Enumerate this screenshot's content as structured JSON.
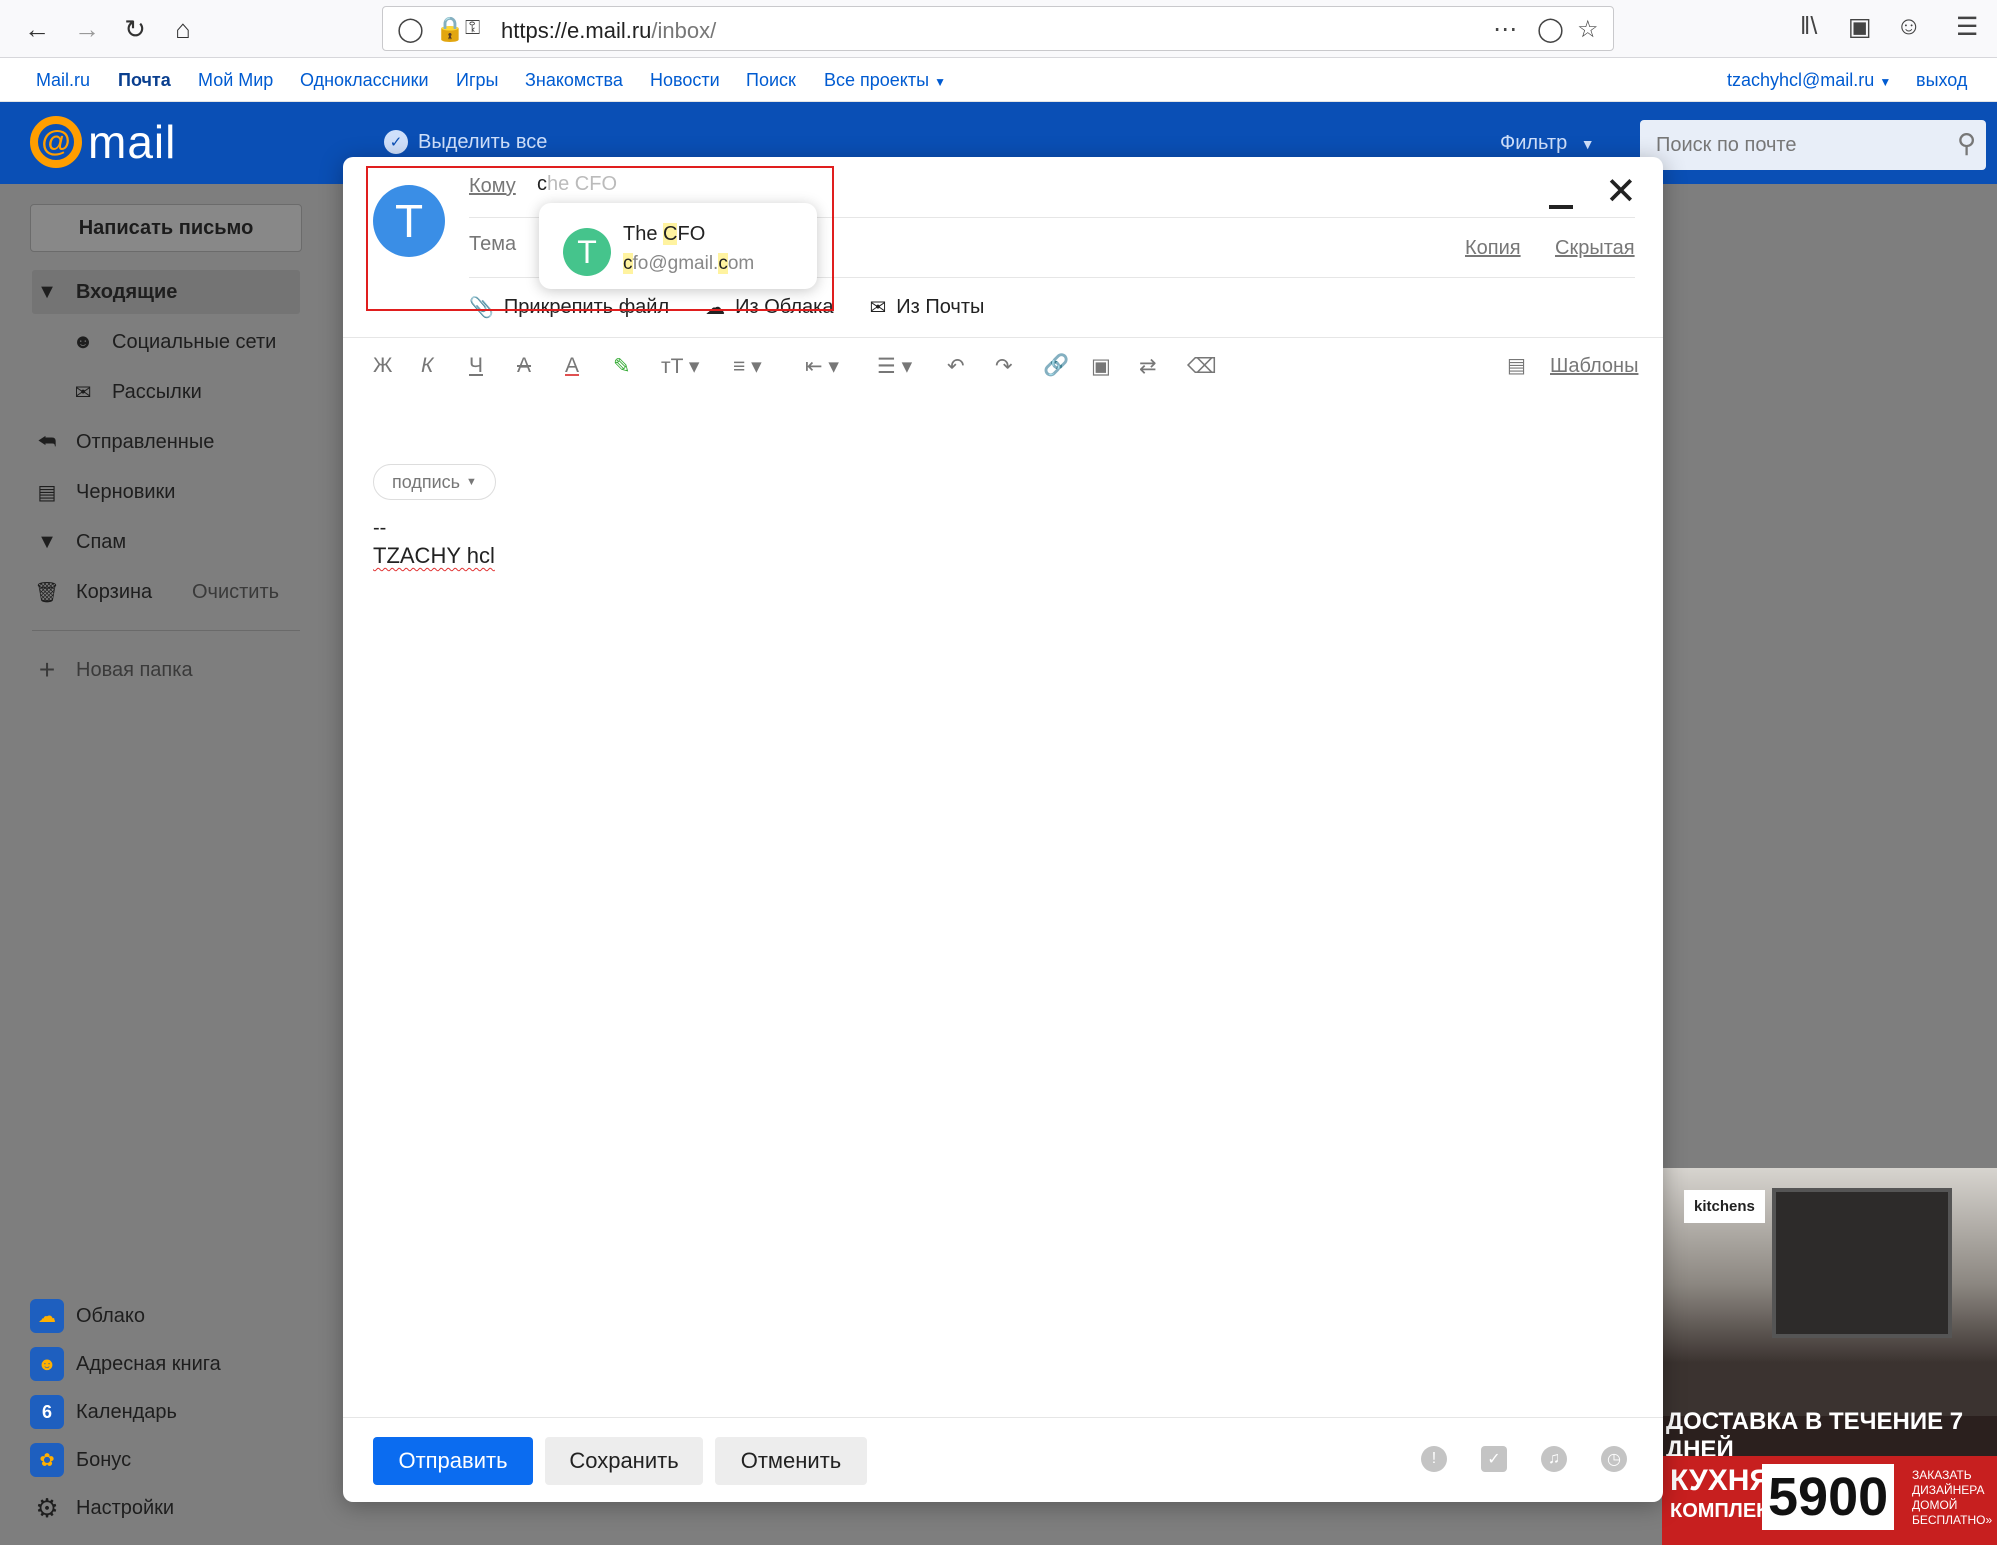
{
  "browser": {
    "url_host": "https://e.mail.ru",
    "url_path": "/inbox/"
  },
  "portal": {
    "links": [
      "Mail.ru",
      "Почта",
      "Мой Мир",
      "Одноклассники",
      "Игры",
      "Знакомства",
      "Новости",
      "Поиск",
      "Все проекты"
    ],
    "user": "tzachyhcl@mail.ru",
    "logout": "выход"
  },
  "header": {
    "logo_text": "mail",
    "select_all": "Выделить все",
    "filter": "Фильтр",
    "search_placeholder": "Поиск по почте"
  },
  "sidebar": {
    "compose": "Написать письмо",
    "folders": [
      {
        "label": "Входящие",
        "icon": "triangle-down-icon"
      },
      {
        "label": "Социальные сети",
        "icon": "people-icon"
      },
      {
        "label": "Рассылки",
        "icon": "newsletter-icon"
      },
      {
        "label": "Отправленные",
        "icon": "reply-icon"
      },
      {
        "label": "Черновики",
        "icon": "draft-icon"
      },
      {
        "label": "Спам",
        "icon": "thumb-down-icon"
      },
      {
        "label": "Корзина",
        "icon": "trash-icon"
      }
    ],
    "clear": "Очистить",
    "new_folder": "Новая папка",
    "apps": [
      {
        "label": "Облако",
        "icon": "cloud-icon"
      },
      {
        "label": "Адресная книга",
        "icon": "contacts-icon"
      },
      {
        "label": "Календарь",
        "icon": "calendar-icon",
        "glyph": "6"
      },
      {
        "label": "Бонус",
        "icon": "bonus-icon"
      },
      {
        "label": "Настройки",
        "icon": "gear-icon"
      }
    ]
  },
  "compose": {
    "avatar_letter": "T",
    "to_label": "Кому",
    "to_typed": "c",
    "to_ghost": "he CFO",
    "subject_label": "Тема",
    "cc": "Копия",
    "bcc": "Скрытая",
    "attach_file": "Прикрепить файл",
    "from_cloud": "Из Облака",
    "from_mail": "Из Почты",
    "templates": "Шаблоны",
    "signature_pill": "подпись",
    "signature_dash": "--",
    "signature_name": "TZACHY hcl",
    "send": "Отправить",
    "save": "Сохранить",
    "cancel": "Отменить"
  },
  "suggestion": {
    "letter": "T",
    "name_pre": "The ",
    "name_hl": "C",
    "name_post": "FO",
    "mail_hl1": "c",
    "mail_mid": "fo@gmail.",
    "mail_hl2": "c",
    "mail_post": "om"
  },
  "toolbar": {
    "bold": "Ж",
    "italic": "К",
    "underline": "Ч",
    "strike": "А",
    "color": "А"
  },
  "ad": {
    "brand": "kitchens",
    "delivery": "ДОСТАВКА В ТЕЧЕНИЕ 7 ДНЕЙ",
    "kitchen": "КУХНЯ",
    "set": "КОМПЛЕКТ",
    "price": "5900",
    "order": "ЗАКАЗАТЬ ДИЗАЙНЕРА ДОМОЙ БЕСПЛАТНО»"
  }
}
